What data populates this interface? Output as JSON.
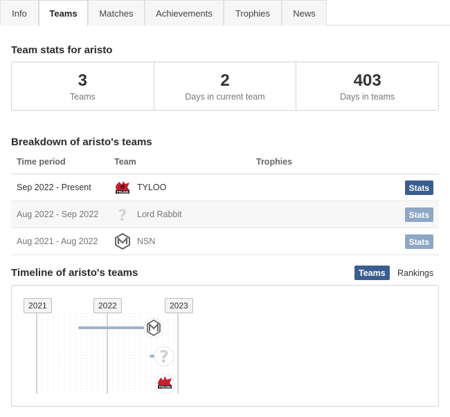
{
  "tabs": [
    {
      "label": "Info",
      "active": false
    },
    {
      "label": "Teams",
      "active": true
    },
    {
      "label": "Matches",
      "active": false
    },
    {
      "label": "Achievements",
      "active": false
    },
    {
      "label": "Trophies",
      "active": false
    },
    {
      "label": "News",
      "active": false
    }
  ],
  "stats_section": {
    "title": "Team stats for aristo",
    "stats": [
      {
        "value": "3",
        "label": "Teams"
      },
      {
        "value": "2",
        "label": "Days in current team"
      },
      {
        "value": "403",
        "label": "Days in teams"
      }
    ]
  },
  "breakdown": {
    "title": "Breakdown of aristo's teams",
    "headers": {
      "period": "Time period",
      "team": "Team",
      "trophies": "Trophies"
    },
    "rows": [
      {
        "period": "Sep 2022 - Present",
        "team": "TYLOO",
        "button": "Stats",
        "logo": "tyloo-logo"
      },
      {
        "period": "Aug 2022 - Sep 2022",
        "team": "Lord Rabbit",
        "button": "Stats",
        "logo": "question-icon"
      },
      {
        "period": "Aug 2021 - Aug 2022",
        "team": "NSN",
        "button": "Stats",
        "logo": "nsn-logo"
      }
    ]
  },
  "timeline": {
    "title": "Timeline of aristo's teams",
    "toggle_teams": "Teams",
    "toggle_rankings": "Rankings",
    "years": [
      "2021",
      "2022",
      "2023"
    ],
    "logo_label": "TYLOO"
  },
  "colors": {
    "accent": "#3a5f8f",
    "accent_faded": "#8da7c4",
    "timeline_bar": "#9fb2cb",
    "tyloo_red": "#c4202d"
  }
}
